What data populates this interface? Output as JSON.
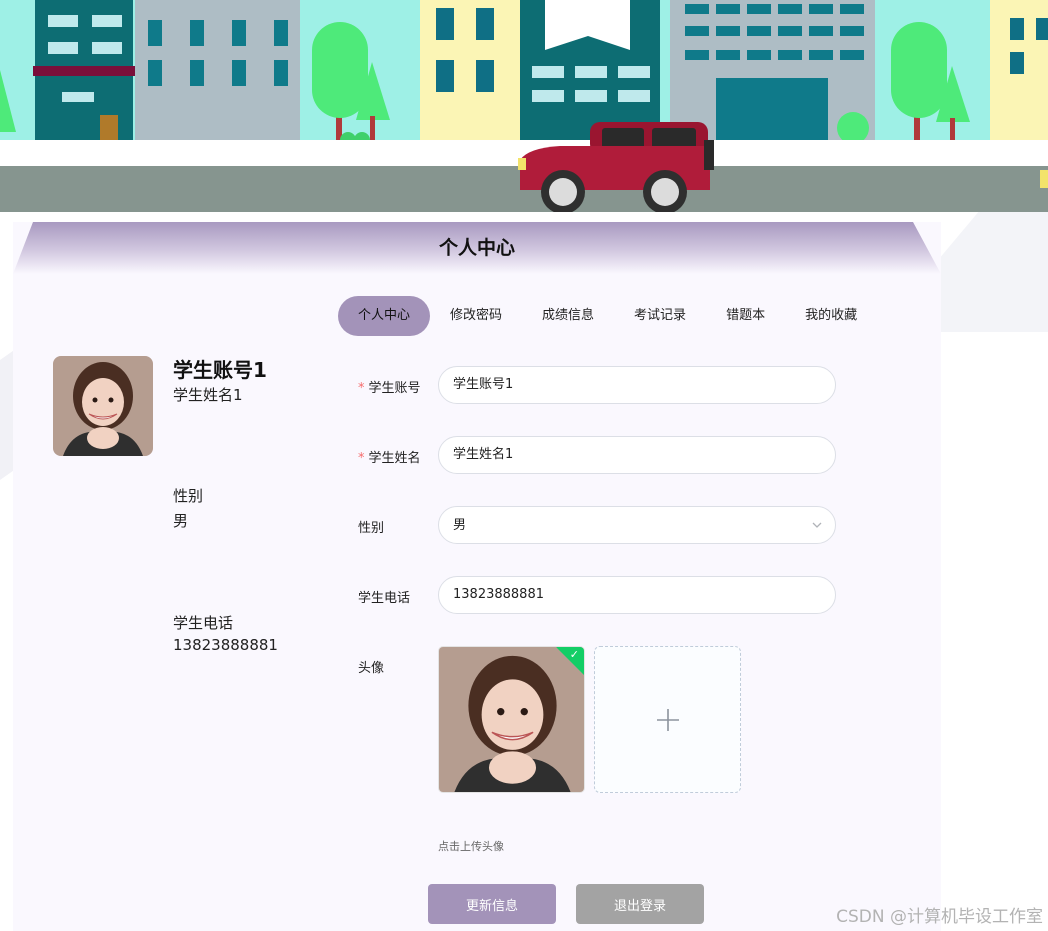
{
  "panel": {
    "title": "个人中心"
  },
  "tabs": [
    {
      "label": "个人中心",
      "active": true
    },
    {
      "label": "修改密码"
    },
    {
      "label": "成绩信息"
    },
    {
      "label": "考试记录"
    },
    {
      "label": "错题本"
    },
    {
      "label": "我的收藏"
    }
  ],
  "info": {
    "account": "学生账号1",
    "name": "学生姓名1",
    "gender_label": "性别",
    "gender_value": "男",
    "phone_label": "学生电话",
    "phone_value": "13823888881"
  },
  "form": {
    "account_label": "学生账号",
    "account_value": "学生账号1",
    "name_label": "学生姓名",
    "name_value": "学生姓名1",
    "gender_label": "性别",
    "gender_value": "男",
    "phone_label": "学生电话",
    "phone_value": "13823888881",
    "avatar_label": "头像",
    "upload_hint": "点击上传头像",
    "update_button": "更新信息",
    "logout_button": "退出登录"
  },
  "watermark": "CSDN @计算机毕设工作室",
  "colors": {
    "accent": "#a393b9",
    "required": "#f56c6c",
    "upload_success": "#13ce66"
  }
}
